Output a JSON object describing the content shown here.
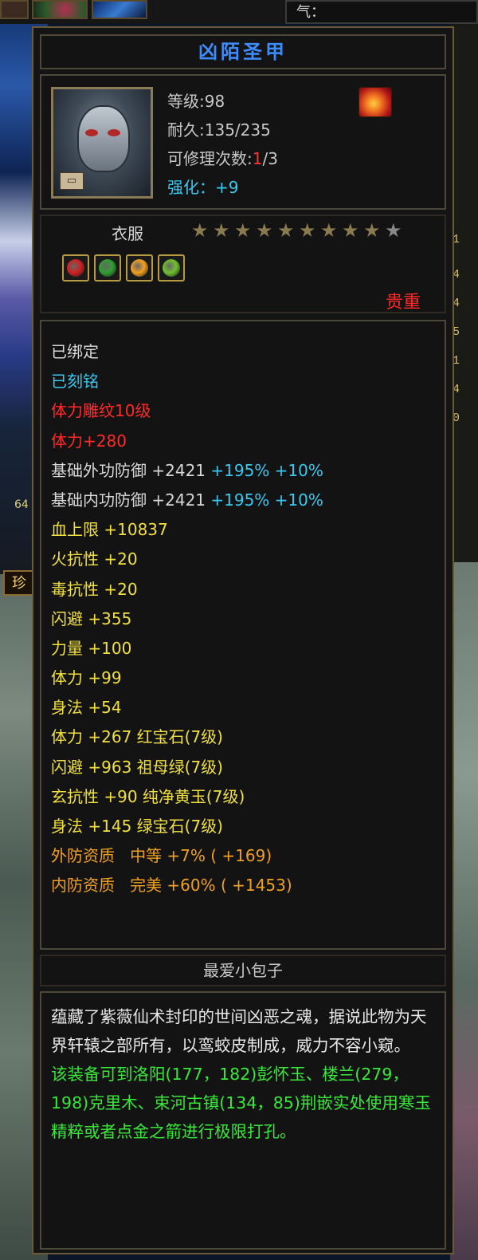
{
  "top_bar": {
    "qi_label": "气："
  },
  "side": {
    "left_number": "64",
    "zhen_button": "珍",
    "right_numbers": [
      "1",
      "4",
      "4",
      "5",
      "1",
      "4",
      "0"
    ]
  },
  "item": {
    "name": "凶陌圣甲",
    "level_label": "等级",
    "level_value": ":98",
    "durability_label": "耐久",
    "durability_value": ":135/235",
    "repair_label": "可修理次数",
    "repair_colon": ":",
    "repair_used": "1",
    "repair_total": "/3",
    "strengthen_label": "强化：",
    "strengthen_value": "+9",
    "type": "衣服",
    "stars_filled": 9,
    "stars_total": 10,
    "rarity": "贵重",
    "gems": [
      {
        "name": "red-gem-icon",
        "color": "#d02020"
      },
      {
        "name": "emerald-gem-icon",
        "color": "#30a030"
      },
      {
        "name": "yellow-jade-icon",
        "color": "#f0a020"
      },
      {
        "name": "green-gem-icon",
        "color": "#70c030"
      }
    ]
  },
  "attributes": [
    {
      "text": "已绑定",
      "color": "white"
    },
    {
      "text": "已刻铭",
      "color": "cyan"
    },
    {
      "text": "体力雕纹10级",
      "color": "red"
    },
    {
      "text": "体力+280",
      "color": "red"
    },
    {
      "text": "基础外功防御 +2421",
      "extra": " +195% +10%",
      "color": "white",
      "extra_color": "cyan"
    },
    {
      "text": "基础内功防御 +2421",
      "extra": " +195% +10%",
      "color": "white",
      "extra_color": "cyan"
    },
    {
      "text": "血上限 +10837",
      "color": "yellow"
    },
    {
      "text": "火抗性 +20",
      "color": "yellow"
    },
    {
      "text": "毒抗性 +20",
      "color": "yellow"
    },
    {
      "text": "闪避 +355",
      "color": "yellow"
    },
    {
      "text": "力量 +100",
      "color": "yellow"
    },
    {
      "text": "体力 +99",
      "color": "yellow"
    },
    {
      "text": "身法 +54",
      "color": "yellow"
    },
    {
      "text": "体力 +267 红宝石(7级)",
      "color": "yellow"
    },
    {
      "text": "闪避 +963 祖母绿(7级)",
      "color": "yellow"
    },
    {
      "text": "玄抗性 +90 纯净黄玉(7级)",
      "color": "yellow"
    },
    {
      "text": "身法 +145 绿宝石(7级)",
      "color": "yellow"
    },
    {
      "text": "外防资质   中等 +7% ( +169)",
      "color": "orange"
    },
    {
      "text": "内防资质   完美 +60% ( +1453)",
      "color": "orange"
    }
  ],
  "author": "最爱小包子",
  "description": {
    "lore": "蕴藏了紫薇仙术封印的世间凶恶之魂，据说此物为天界轩辕之部所有，以鸾蛟皮制成，威力不容小窥。",
    "hint": "该装备可到洛阳(177，182)彭怀玉、楼兰(279，198)克里木、束河古镇(134，85)荆嵌实处使用寒玉精粹或者点金之箭进行极限打孔。"
  },
  "colors": {
    "title_blue": "#3c8cff",
    "cyan": "#38c8f0",
    "red": "#ff2a2a",
    "yellow": "#f0e040",
    "orange": "#f0a020",
    "green": "#38e838",
    "border": "#6a5a3a"
  }
}
